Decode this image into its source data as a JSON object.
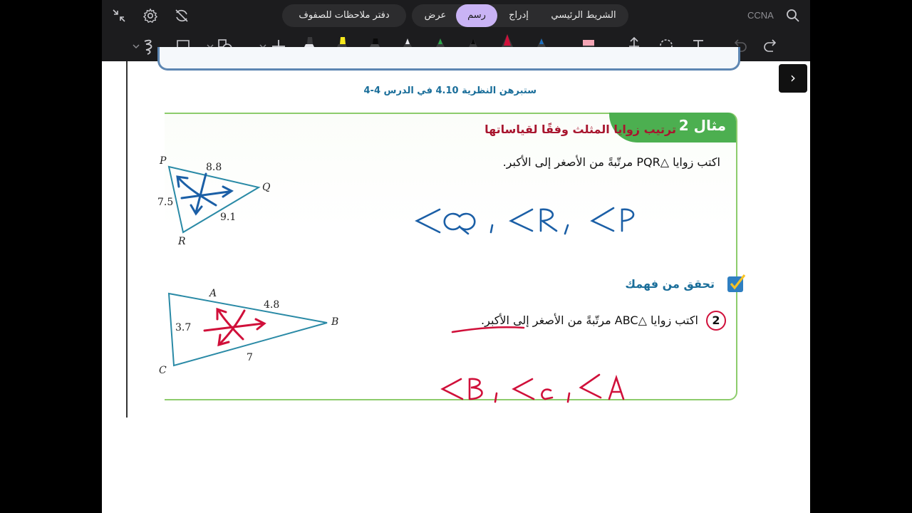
{
  "toolbar": {
    "tabs": [
      "الشريط الرئيسي",
      "إدراج",
      "رسم",
      "عرض"
    ],
    "active_tab": "رسم",
    "notebook_name": "دفتر ملاحظات للصفوف",
    "section_name": "CCNA"
  },
  "page": {
    "theorem_note": "ستبرهن النظرية 4.10 في الدرس 4-4",
    "example": {
      "label": "مثال 2",
      "title": "ترتيب زوايا المثلث وفقًا لقياساتها",
      "question": "اكتب زوايا △PQR مرتّبةً من الأصغر إلى الأكبر."
    },
    "triangle1": {
      "vertices": [
        "P",
        "Q",
        "R"
      ],
      "sides": [
        "8.8",
        "7.5",
        "9.1"
      ]
    },
    "check": {
      "label": "تحقق من فهمك",
      "number": "2",
      "question": "اكتب زوايا △ABC مرتّبةً من الأصغر إلى الأكبر."
    },
    "triangle2": {
      "vertices": [
        "A",
        "B",
        "C"
      ],
      "sides": [
        "4.8",
        "3.7",
        "7"
      ]
    }
  },
  "colors": {
    "ink_blue": "#1b5fa6",
    "ink_red": "#d0103a",
    "highlight_lavender": "#c9b3f5",
    "green_header": "#4caf50",
    "title_red": "#a8152e"
  },
  "icons": [
    "collapse-icon",
    "settings-icon",
    "no-sync-icon",
    "search-icon",
    "lasso-icon",
    "shapes-icon",
    "add-icon",
    "highlighter-icon",
    "pen-icon",
    "pencil-icon",
    "eraser-icon",
    "insert-space-icon",
    "lasso-select-icon",
    "text-icon",
    "undo-icon",
    "redo-icon",
    "chevron-right-icon"
  ]
}
